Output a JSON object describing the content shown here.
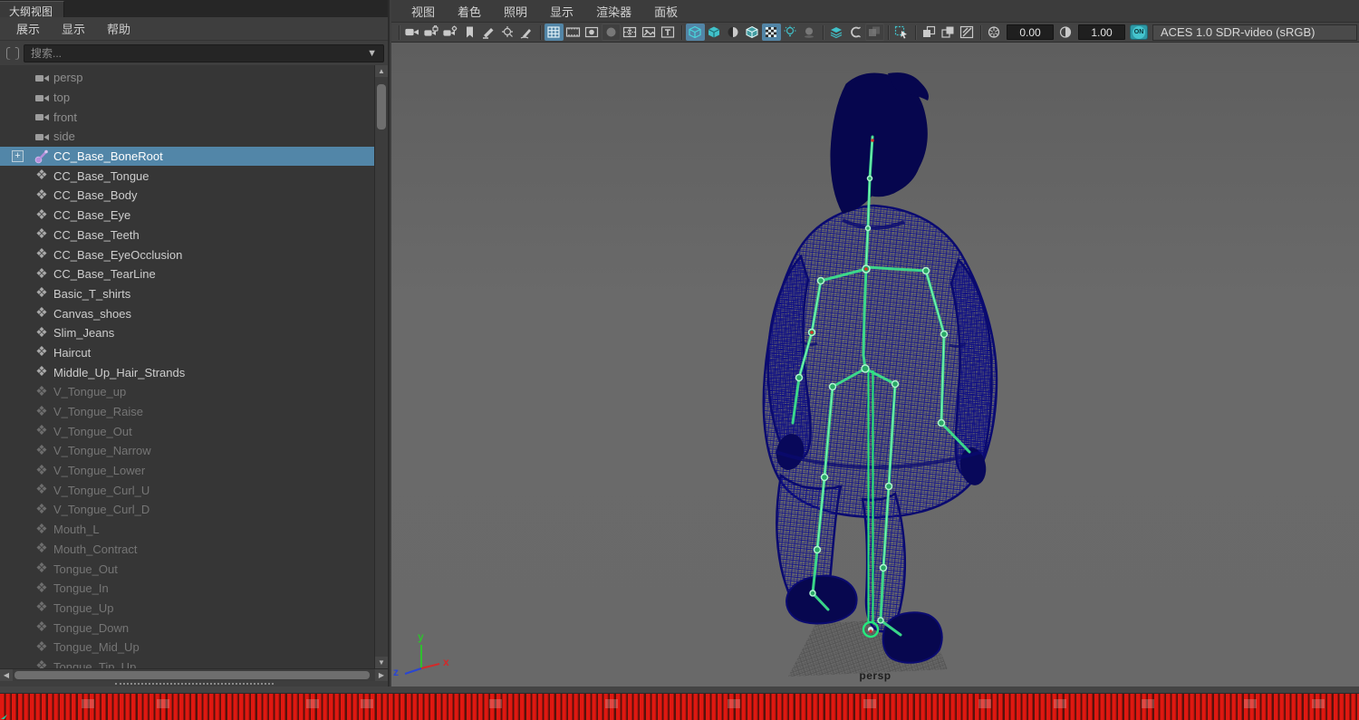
{
  "outliner": {
    "tab_title": "大纲视图",
    "menus": [
      {
        "key": "display",
        "label": "展示"
      },
      {
        "key": "show",
        "label": "显示"
      },
      {
        "key": "help",
        "label": "帮助"
      }
    ],
    "search": {
      "placeholder": "搜索..."
    },
    "items": [
      {
        "label": "persp",
        "type": "camera",
        "state": "muted"
      },
      {
        "label": "top",
        "type": "camera",
        "state": "muted"
      },
      {
        "label": "front",
        "type": "camera",
        "state": "muted"
      },
      {
        "label": "side",
        "type": "camera",
        "state": "muted"
      },
      {
        "label": "CC_Base_BoneRoot",
        "type": "joint",
        "state": "selected",
        "expandable": true
      },
      {
        "label": "CC_Base_Tongue",
        "type": "mesh",
        "state": "normal"
      },
      {
        "label": "CC_Base_Body",
        "type": "mesh",
        "state": "normal"
      },
      {
        "label": "CC_Base_Eye",
        "type": "mesh",
        "state": "normal"
      },
      {
        "label": "CC_Base_Teeth",
        "type": "mesh",
        "state": "normal"
      },
      {
        "label": "CC_Base_EyeOcclusion",
        "type": "mesh",
        "state": "normal"
      },
      {
        "label": "CC_Base_TearLine",
        "type": "mesh",
        "state": "normal"
      },
      {
        "label": "Basic_T_shirts",
        "type": "mesh",
        "state": "normal"
      },
      {
        "label": "Canvas_shoes",
        "type": "mesh",
        "state": "normal"
      },
      {
        "label": "Slim_Jeans",
        "type": "mesh",
        "state": "normal"
      },
      {
        "label": "Haircut",
        "type": "mesh",
        "state": "normal"
      },
      {
        "label": "Middle_Up_Hair_Strands",
        "type": "mesh",
        "state": "normal"
      },
      {
        "label": "V_Tongue_up",
        "type": "mesh",
        "state": "dim"
      },
      {
        "label": "V_Tongue_Raise",
        "type": "mesh",
        "state": "dim"
      },
      {
        "label": "V_Tongue_Out",
        "type": "mesh",
        "state": "dim"
      },
      {
        "label": "V_Tongue_Narrow",
        "type": "mesh",
        "state": "dim"
      },
      {
        "label": "V_Tongue_Lower",
        "type": "mesh",
        "state": "dim"
      },
      {
        "label": "V_Tongue_Curl_U",
        "type": "mesh",
        "state": "dim"
      },
      {
        "label": "V_Tongue_Curl_D",
        "type": "mesh",
        "state": "dim"
      },
      {
        "label": "Mouth_L",
        "type": "mesh",
        "state": "dim"
      },
      {
        "label": "Mouth_Contract",
        "type": "mesh",
        "state": "dim"
      },
      {
        "label": "Tongue_Out",
        "type": "mesh",
        "state": "dim"
      },
      {
        "label": "Tongue_In",
        "type": "mesh",
        "state": "dim"
      },
      {
        "label": "Tongue_Up",
        "type": "mesh",
        "state": "dim"
      },
      {
        "label": "Tongue_Down",
        "type": "mesh",
        "state": "dim"
      },
      {
        "label": "Tongue_Mid_Up",
        "type": "mesh",
        "state": "dim"
      },
      {
        "label": "Tonque_Tip_Up",
        "type": "mesh",
        "state": "dim"
      }
    ]
  },
  "viewport": {
    "menus": [
      {
        "key": "view",
        "label": "视图"
      },
      {
        "key": "shading",
        "label": "着色"
      },
      {
        "key": "lighting",
        "label": "照明"
      },
      {
        "key": "show",
        "label": "显示"
      },
      {
        "key": "renderer",
        "label": "渲染器"
      },
      {
        "key": "panels",
        "label": "面板"
      }
    ],
    "toolbar": {
      "items": [
        {
          "name": "separator"
        },
        {
          "name": "camera-icon",
          "glyph": "camera"
        },
        {
          "name": "camera-lock-icon",
          "glyph": "camera-lock"
        },
        {
          "name": "camera-attrs-icon",
          "glyph": "camera-gear"
        },
        {
          "name": "bookmark-icon",
          "glyph": "bookmark"
        },
        {
          "name": "grease-pencil-icon",
          "glyph": "pencil"
        },
        {
          "name": "pan-zoom-icon",
          "glyph": "panzoom"
        },
        {
          "name": "grease-pencil-edit-icon",
          "glyph": "pencil2"
        },
        {
          "name": "separator"
        },
        {
          "name": "grid-toggle-icon",
          "glyph": "grid",
          "active": true
        },
        {
          "name": "film-gate-icon",
          "glyph": "filmgate"
        },
        {
          "name": "resolution-gate-icon",
          "glyph": "resgate"
        },
        {
          "name": "gate-mask-icon",
          "glyph": "gatemask",
          "dim": true,
          "framed": true
        },
        {
          "name": "field-chart-icon",
          "glyph": "fieldchart"
        },
        {
          "name": "image-plane-icon",
          "glyph": "imageplane"
        },
        {
          "name": "hud-icon",
          "glyph": "hud"
        },
        {
          "name": "separator"
        },
        {
          "name": "wireframe-icon",
          "glyph": "cube-wire",
          "active": true,
          "teal": true
        },
        {
          "name": "smooth-shade-icon",
          "glyph": "cube-solid",
          "teal": true
        },
        {
          "name": "flat-shade-icon",
          "glyph": "sphere-half"
        },
        {
          "name": "wireframe-on-shaded-icon",
          "glyph": "cube-wos",
          "teal": true
        },
        {
          "name": "textured-icon",
          "glyph": "checker",
          "active": true
        },
        {
          "name": "lights-icon",
          "glyph": "bulb",
          "teal": true
        },
        {
          "name": "shadows-icon",
          "glyph": "shadow",
          "dim": true
        },
        {
          "name": "separator"
        },
        {
          "name": "ssao-icon",
          "glyph": "layers",
          "teal": true
        },
        {
          "name": "motion-blur-icon",
          "glyph": "mblur"
        },
        {
          "name": "antialias-icon",
          "glyph": "squares",
          "dim": true,
          "framed": true
        },
        {
          "name": "separator"
        },
        {
          "name": "selection-highlight-icon",
          "glyph": "cursorbox",
          "teal": true
        },
        {
          "name": "separator"
        },
        {
          "name": "isolate-select-icon",
          "glyph": "iso-a"
        },
        {
          "name": "isolate-add-icon",
          "glyph": "iso-b"
        },
        {
          "name": "xray-icon",
          "glyph": "xray"
        },
        {
          "name": "separator"
        },
        {
          "name": "exposure-icon",
          "glyph": "aperture"
        },
        {
          "name": "field",
          "field": "exposure"
        },
        {
          "name": "gamma-icon",
          "glyph": "gamma"
        },
        {
          "name": "field",
          "field": "gamma"
        },
        {
          "name": "on-toggle"
        },
        {
          "name": "aces-field"
        }
      ],
      "exposure": "0.00",
      "gamma": "1.00",
      "on_label": "ON",
      "view_transform": "ACES 1.0 SDR-video (sRGB)"
    },
    "camera_label": "persp",
    "axis_gizmo": {
      "x": "x",
      "y": "y",
      "z": "z"
    }
  },
  "timeline": {
    "keyed_range": "full",
    "key_color": "#df1811",
    "smudges_x_pct": [
      6,
      11.5,
      22.5,
      26.5,
      36,
      44.5,
      53.5,
      63.5,
      72,
      77.5,
      84,
      91.5,
      96.5
    ]
  },
  "colors": {
    "selection_blue": "#5286a8",
    "accent_teal": "#41c1c9",
    "wire_navy": "#10108c",
    "skeleton_green": "#3ce08c",
    "timeline_red": "#df1811",
    "viewport_gray": "#666666"
  }
}
